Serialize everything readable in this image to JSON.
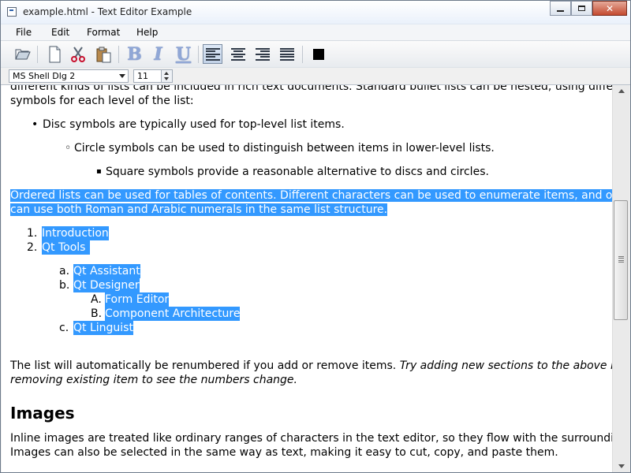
{
  "window": {
    "title": "example.html - Text Editor Example",
    "close_glyph": "✕"
  },
  "menu": [
    {
      "label": "File"
    },
    {
      "label": "Edit"
    },
    {
      "label": "Format"
    },
    {
      "label": "Help"
    }
  ],
  "toolbar": {
    "icons": [
      "open-icon",
      "new-icon",
      "cut-icon",
      "paste-icon"
    ],
    "bold_glyph": "B",
    "italic_glyph": "I",
    "underline_glyph": "U",
    "active_alignment": "left",
    "text_color": "#000000"
  },
  "font": {
    "family": "MS Shell Dlg 2",
    "size": "11"
  },
  "document": {
    "cut_line": "different kinds of lists can be included in rich text documents. Standard bullet lists can be nested, using different",
    "intro": "symbols for each level of the list:",
    "bullets": [
      {
        "glyph": "•",
        "text": "Disc symbols are typically used for top-level list items."
      },
      {
        "glyph": "◦",
        "text": "Circle symbols can be used to distinguish between items in lower-level lists."
      },
      {
        "glyph": "▪",
        "text": "Square symbols provide a reasonable alternative to discs and circles."
      }
    ],
    "ordered_line1": "Ordered lists can be used for tables of contents. Different characters can be used to enumerate items, and one",
    "ordered_line2": "can use both Roman and Arabic numerals in the same list structure.",
    "list": [
      {
        "marker": "1.",
        "text": "Introduction"
      },
      {
        "marker": "2.",
        "text": "Qt Tools"
      },
      {
        "marker": "a.",
        "text": "Qt Assistant"
      },
      {
        "marker": "b.",
        "text": "Qt Designer"
      },
      {
        "marker": "A.",
        "text": "Form Editor"
      },
      {
        "marker": "B.",
        "text": "Component Architecture"
      },
      {
        "marker": "c.",
        "text": "Qt Linguist"
      }
    ],
    "renumber_normal": "The list will automatically be renumbered if you add or remove items.",
    "renumber_italic1": "Try adding new sections to the above list or",
    "renumber_italic2": "removing existing item to see the numbers change.",
    "images_heading": "Images",
    "images_line1": "Inline images are treated like ordinary ranges of characters in the text editor, so they flow with the surrounding text.",
    "images_line2": "Images can also be selected in the same way as text, making it easy to cut, copy, and paste them."
  },
  "colors": {
    "selection": "#3399ff",
    "selection_text": "#ffffff"
  }
}
